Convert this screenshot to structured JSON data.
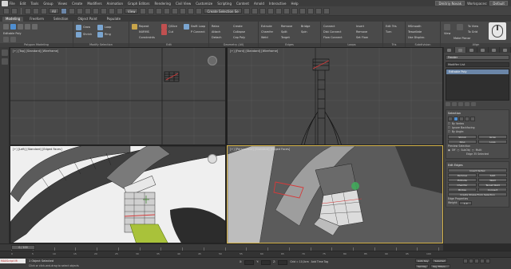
{
  "menu": {
    "items": [
      "File",
      "Edit",
      "Tools",
      "Group",
      "Views",
      "Create",
      "Modifiers",
      "Animation",
      "Graph Editors",
      "Rendering",
      "Civil View",
      "Customize",
      "Scripting",
      "Content",
      "Arnold",
      "Interactive",
      "Help"
    ],
    "user": "Dmitriy Novak",
    "workspaces_label": "Workspaces:",
    "workspace_value": "Default"
  },
  "toolbar": {
    "filter_value": "All",
    "view_value": "View",
    "selection_set": "Create Selection Se"
  },
  "ribbon_tabs": [
    "Modeling",
    "Freeform",
    "Selection",
    "Object Paint",
    "Populate"
  ],
  "ribbon": {
    "polygon_modeling": {
      "title": "Polygon Modeling",
      "items": [
        "Editable Poly"
      ]
    },
    "modify_selection": {
      "title": "Modify Selection",
      "items": [
        "Grow",
        "Shrink",
        "Loop",
        "Ring"
      ]
    },
    "edit": {
      "title": "Edit",
      "items": [
        "Repeat",
        "QSlice",
        "Swift Loop",
        "NURMS",
        "Cut",
        "P Connect",
        "Constraints"
      ]
    },
    "geometry": {
      "title": "Geometry (All)",
      "items": [
        "Relax",
        "Create",
        "Attach",
        "Collapse",
        "Detach",
        "Cap Poly"
      ]
    },
    "edges": {
      "title": "Edges",
      "items": [
        "Extrude",
        "Remove",
        "Bridge",
        "Chamfer",
        "Split",
        "Spin",
        "Weld",
        "Target"
      ]
    },
    "loops": {
      "title": "Loops",
      "items": [
        "Connect",
        "Insert",
        "Dist Connect",
        "Remove",
        "Flow Connect",
        "Set Flow"
      ]
    },
    "tris": {
      "title": "Tris",
      "items": [
        "Edit Tris",
        "Turn"
      ]
    },
    "subdivision": {
      "title": "Subdivision",
      "items": [
        "MSmooth",
        "Tessellate",
        "Use Displac."
      ]
    },
    "align": {
      "title": "Align",
      "items": [
        "View",
        "Make Planar",
        "To View",
        "To Grid"
      ]
    }
  },
  "viewports": {
    "top_left": {
      "label": "[+] [Top] [Standard] [Wireframe]"
    },
    "top_right": {
      "label": "[+] [Front] [Standard] [Wireframe]"
    },
    "bottom_left": {
      "label": "[+] [Left] [Standard] [Edged Faces]"
    },
    "bottom_right": {
      "label": "[+] [Perspective] [Standard] [Edged Faces]"
    }
  },
  "command_panel": {
    "object_name": "Fender",
    "modifier_list": "Modifier List",
    "stack_item": "Editable Poly",
    "selection": {
      "title": "Selection",
      "by_vertex": "By Vertex",
      "ignore_backfacing": "Ignore Backfacing",
      "by_angle": "By Angle:",
      "buttons": [
        "Shrink",
        "Grow",
        "Ring",
        "Loop"
      ],
      "preview": "Preview Selection",
      "preview_opts": [
        "Off",
        "SubObj",
        "Multi"
      ],
      "summary": "Edge 35 Selected"
    },
    "edit_edges": {
      "title": "Edit Edges",
      "insert_vertex": "Insert Vertex",
      "rows": [
        [
          "Remove",
          "Split"
        ],
        [
          "Extrude",
          "Weld"
        ],
        [
          "Chamfer",
          "Target Weld"
        ],
        [
          "Bridge",
          "Connect"
        ]
      ],
      "create_shape": "Create Shape From Selection",
      "edge_props": "Edge Properties",
      "weight": "Weight:",
      "weight_value": "1.0"
    }
  },
  "timeline": {
    "slider": "0 / 100"
  },
  "trackbar": {
    "ticks": [
      "0",
      "5",
      "10",
      "15",
      "20",
      "25",
      "30",
      "35",
      "40",
      "45",
      "50",
      "55",
      "60",
      "65",
      "70",
      "75",
      "80",
      "85",
      "90",
      "95",
      "100"
    ]
  },
  "status": {
    "maxscript": "MAXScript Mi",
    "message": "1 Object Selected",
    "hint": "Click or click-and-drag to select objects",
    "x": "X:",
    "y": "Y:",
    "z": "Z:",
    "grid": "Grid = 10,0cm",
    "add_time_tag": "Add Time Tag",
    "auto_key": "Auto Key",
    "selected": "Selected",
    "set_key": "Set Key",
    "key_filters": "Key Filters..."
  },
  "colors": {
    "accent": "#6b86a8",
    "active_border": "#d6b44a",
    "selection_red": "#d63a3a",
    "viewport_bg": "#484848"
  }
}
